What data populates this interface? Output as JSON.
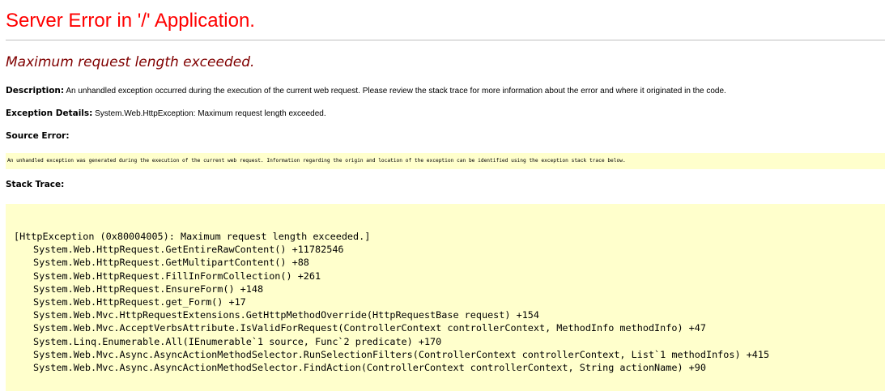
{
  "page": {
    "title": "Server Error in '/' Application.",
    "subtitle": "Maximum request length exceeded.",
    "description": {
      "label": "Description:",
      "text": " An unhandled exception occurred during the execution of the current web request. Please review the stack trace for more information about the error and where it originated in the code."
    },
    "exception_details": {
      "label": "Exception Details:",
      "text": " System.Web.HttpException: Maximum request length exceeded."
    },
    "source_error": {
      "heading": "Source Error:",
      "text": "An unhandled exception was generated during the execution of the current web request. Information regarding the origin and location of the exception can be identified using the exception stack trace below."
    },
    "stack_trace": {
      "heading": "Stack Trace:",
      "lines": [
        "[HttpException (0x80004005): Maximum request length exceeded.]",
        "System.Web.HttpRequest.GetEntireRawContent() +11782546",
        "System.Web.HttpRequest.GetMultipartContent() +88",
        "System.Web.HttpRequest.FillInFormCollection() +261",
        "System.Web.HttpRequest.EnsureForm() +148",
        "System.Web.HttpRequest.get_Form() +17",
        "System.Web.Mvc.HttpRequestExtensions.GetHttpMethodOverride(HttpRequestBase request) +154",
        "System.Web.Mvc.AcceptVerbsAttribute.IsValidForRequest(ControllerContext controllerContext, MethodInfo methodInfo) +47",
        "System.Linq.Enumerable.All(IEnumerable`1 source, Func`2 predicate) +170",
        "System.Web.Mvc.Async.AsyncActionMethodSelector.RunSelectionFilters(ControllerContext controllerContext, List`1 methodInfos) +415",
        "System.Web.Mvc.Async.AsyncActionMethodSelector.FindAction(ControllerContext controllerContext, String actionName) +90"
      ]
    }
  },
  "colors": {
    "title": "#ff0000",
    "subtitle": "#800000",
    "code_background": "#ffffcc",
    "rule": "#c0c0c0"
  }
}
